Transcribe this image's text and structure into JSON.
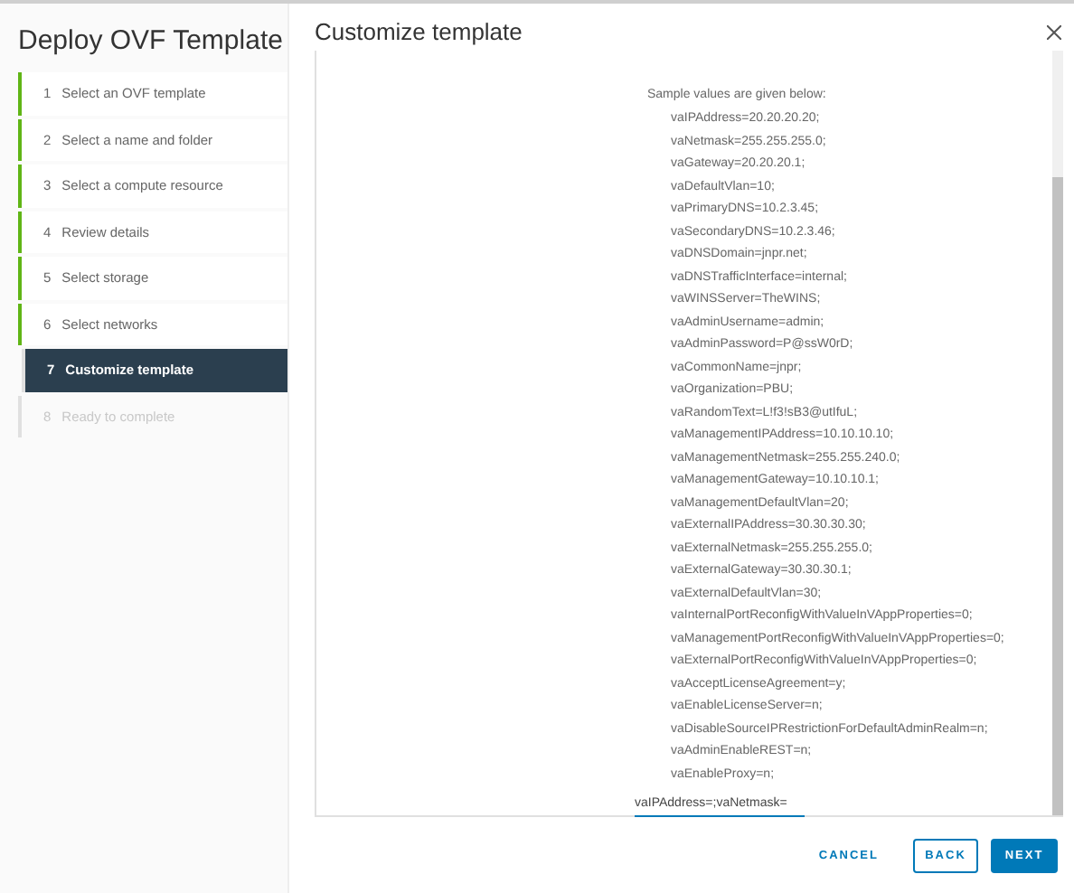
{
  "wizard": {
    "title": "Deploy OVF Template"
  },
  "steps": [
    {
      "number": "1",
      "label": "Select an OVF template",
      "completed": true,
      "selected": false,
      "disabled": false
    },
    {
      "number": "2",
      "label": "Select a name and folder",
      "completed": true,
      "selected": false,
      "disabled": false
    },
    {
      "number": "3",
      "label": "Select a compute resource",
      "completed": true,
      "selected": false,
      "disabled": false
    },
    {
      "number": "4",
      "label": "Review details",
      "completed": true,
      "selected": false,
      "disabled": false
    },
    {
      "number": "5",
      "label": "Select storage",
      "completed": true,
      "selected": false,
      "disabled": false
    },
    {
      "number": "6",
      "label": "Select networks",
      "completed": true,
      "selected": false,
      "disabled": false
    },
    {
      "number": "7",
      "label": "Customize template",
      "completed": false,
      "selected": true,
      "disabled": false
    },
    {
      "number": "8",
      "label": "Ready to complete",
      "completed": false,
      "selected": false,
      "disabled": true
    }
  ],
  "page": {
    "title": "Customize template",
    "intro": "Sample values are given below:",
    "sample_lines": [
      "vaIPAddress=20.20.20.20;",
      "vaNetmask=255.255.255.0;",
      "vaGateway=20.20.20.1;",
      "vaDefaultVlan=10;",
      "vaPrimaryDNS=10.2.3.45;",
      "vaSecondaryDNS=10.2.3.46;",
      "vaDNSDomain=jnpr.net;",
      "vaDNSTrafficInterface=internal;",
      "vaWINSServer=TheWINS;",
      "vaAdminUsername=admin;",
      "vaAdminPassword=P@ssW0rD;",
      "vaCommonName=jnpr;",
      "vaOrganization=PBU;",
      "vaRandomText=L!f3!sB3@utIfuL;",
      "vaManagementIPAddress=10.10.10.10;",
      "vaManagementNetmask=255.255.240.0;",
      "vaManagementGateway=10.10.10.1;",
      "vaManagementDefaultVlan=20;",
      "vaExternalIPAddress=30.30.30.30;",
      "vaExternalNetmask=255.255.255.0;",
      "vaExternalGateway=30.30.30.1;",
      "vaExternalDefaultVlan=30;",
      "vaInternalPortReconfigWithValueInVAppProperties=0;",
      "vaManagementPortReconfigWithValueInVAppProperties=0;",
      "vaExternalPortReconfigWithValueInVAppProperties=0;",
      "vaAcceptLicenseAgreement=y;",
      "vaEnableLicenseServer=n;",
      "vaDisableSourceIPRestrictionForDefaultAdminRealm=n;",
      "vaAdminEnableREST=n;",
      "vaEnableProxy=n;"
    ],
    "field": {
      "value": "vaIPAddress=;vaNetmask="
    }
  },
  "buttons": [
    {
      "label": "CANCEL",
      "kind": "flat"
    },
    {
      "label": "BACK",
      "kind": "outline"
    },
    {
      "label": "NEXT",
      "kind": "primary"
    }
  ]
}
